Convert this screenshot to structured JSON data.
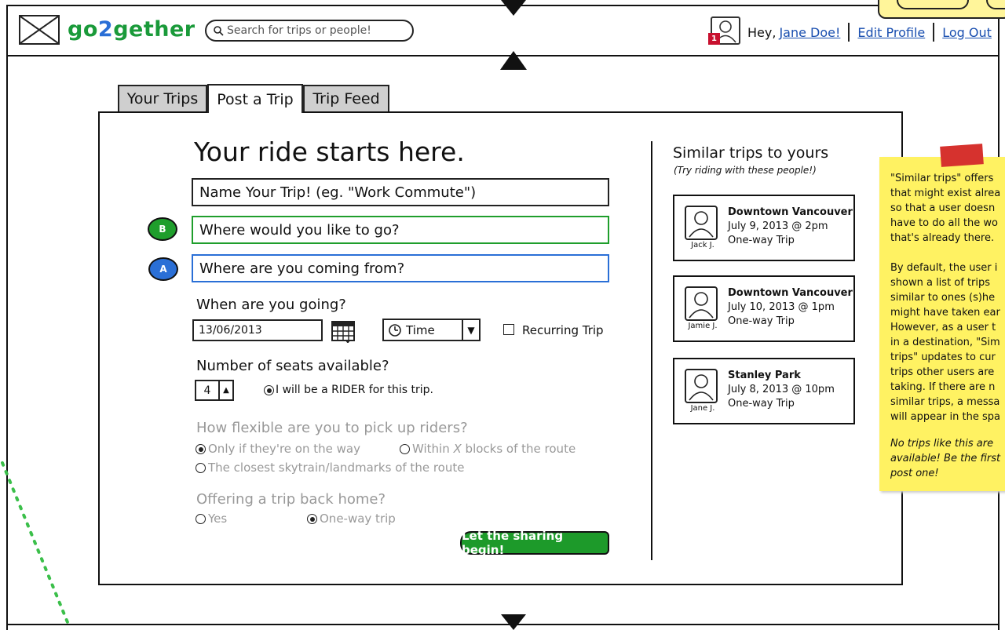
{
  "header": {
    "brand_go": "go",
    "brand_2": "2",
    "brand_gether": "gether",
    "search_placeholder": "Search for trips or people!",
    "notification_count": "1",
    "greeting": "Hey,",
    "user_name": "Jane Doe!",
    "edit_profile": "Edit Profile",
    "log_out": "Log Out"
  },
  "tabs": [
    {
      "label": "Your Trips"
    },
    {
      "label": "Post a Trip"
    },
    {
      "label": "Trip Feed"
    }
  ],
  "form": {
    "heading": "Your ride starts here.",
    "trip_name": "Name Your Trip! (eg. \"Work Commute\")",
    "destination_marker": "B",
    "destination": "Where would you like to go?",
    "origin_marker": "A",
    "origin": "Where are you coming from?",
    "when_label": "When are you going?",
    "date_value": "13/06/2013",
    "time_label": "Time",
    "recurring_label": "Recurring Trip",
    "seats_label": "Number of seats available?",
    "seats_value": "4",
    "rider_label": "I will be a RIDER for this trip.",
    "flex_label": "How flexible are you to pick up riders?",
    "flex_opt1": "Only if they're on the way",
    "flex_opt2_pre": "Within ",
    "flex_opt2_x": "X",
    "flex_opt2_post": " blocks of the route",
    "flex_opt3": "The closest skytrain/landmarks of the route",
    "return_label": "Offering a trip back home?",
    "return_yes": "Yes",
    "return_oneway": "One-way trip",
    "submit": "Let the sharing begin!"
  },
  "similar": {
    "title": "Similar trips to yours",
    "subtitle": "(Try riding with these people!)",
    "trips": [
      {
        "user": "Jack J.",
        "place": "Downtown Vancouver",
        "when": "July 9, 2013 @ 2pm",
        "kind": "One-way Trip"
      },
      {
        "user": "Jamie J.",
        "place": "Downtown Vancouver",
        "when": "July 10, 2013 @ 1pm",
        "kind": "One-way Trip"
      },
      {
        "user": "Jane J.",
        "place": "Stanley Park",
        "when": "July 8, 2013 @ 10pm",
        "kind": "One-way Trip"
      }
    ]
  },
  "note": {
    "para1": "\"Similar trips\" offers\nthat might exist alrea\nso that a user doesn\nhave to do all the wo\nthat's already there.",
    "para2": "By default, the user i\nshown a list of trips\nsimilar to ones (s)he\nmight have taken ear\nHowever, as a user t\nin a destination, \"Sim\ntrips\" updates to cur\ntrips other users are\ntaking. If there are n\nsimilar trips, a messa\nwill appear in the spa",
    "para3": "No trips like this are\navailable! Be the first\npost one!"
  },
  "colors": {
    "green": "#1d9a2a",
    "blue": "#2a6fd6",
    "note": "#fff262",
    "tape": "#d6322e"
  }
}
